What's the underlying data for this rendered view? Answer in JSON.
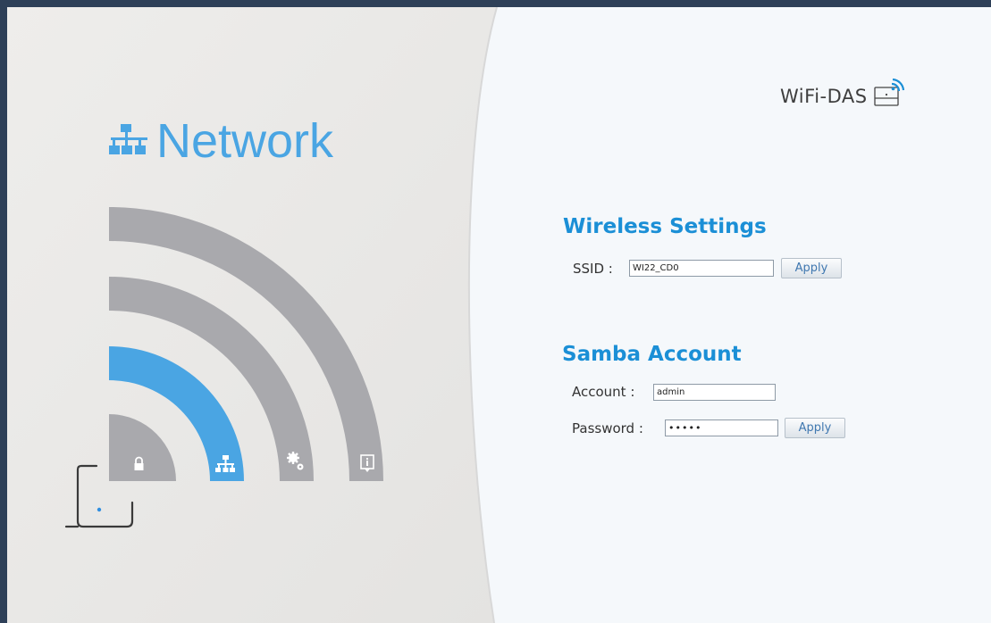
{
  "brand": {
    "name": "WiFi-DAS"
  },
  "nav": {
    "title": "Network",
    "active": "network",
    "colors": {
      "active": "#4aa5e3",
      "inactive": "#a9a9ad",
      "title": "#4aa5e3"
    },
    "items": [
      {
        "id": "security",
        "icon": "lock-icon"
      },
      {
        "id": "network",
        "icon": "network-icon"
      },
      {
        "id": "settings",
        "icon": "gear-icon"
      },
      {
        "id": "info",
        "icon": "info-icon"
      }
    ]
  },
  "wireless": {
    "title": "Wireless Settings",
    "ssid_label": "SSID :",
    "ssid_value": "WI22_CD0",
    "apply_label": "Apply"
  },
  "samba": {
    "title": "Samba Account",
    "account_label": "Account :",
    "account_value": "admin",
    "password_label": "Password :",
    "password_value": "•••••",
    "apply_label": "Apply"
  },
  "colors": {
    "accent": "#1b8fd6"
  }
}
